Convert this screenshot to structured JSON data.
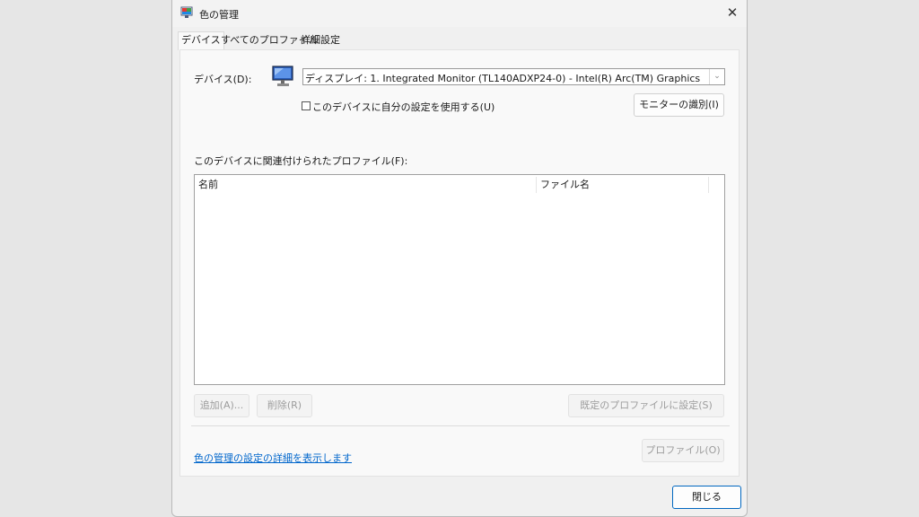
{
  "window": {
    "title": "色の管理",
    "close_glyph": "✕"
  },
  "tabs": [
    {
      "label": "デバイス",
      "active": true
    },
    {
      "label": "すべてのプロファイル",
      "active": false
    },
    {
      "label": "詳細設定",
      "active": false
    }
  ],
  "device": {
    "label": "デバイス(D):",
    "selected": "ディスプレイ: 1. Integrated Monitor (TL140ADXP24-0) - Intel(R) Arc(TM) Graphics",
    "dropdown_glyph": "⌄",
    "checkbox_label": "このデバイスに自分の設定を使用する(U)",
    "checkbox_checked": false,
    "identify_button": "モニターの識別(I)"
  },
  "profiles": {
    "label": "このデバイスに関連付けられたプロファイル(F):",
    "columns": [
      "名前",
      "ファイル名"
    ],
    "rows": []
  },
  "actions": {
    "add": "追加(A)...",
    "remove": "削除(R)",
    "set_default": "既定のプロファイルに設定(S)",
    "profiles_button": "プロファイル(O)"
  },
  "footer": {
    "link": "色の管理の設定の詳細を表示します",
    "close_button": "閉じる"
  },
  "colors": {
    "accent": "#0067c0",
    "link": "#0066cc"
  }
}
